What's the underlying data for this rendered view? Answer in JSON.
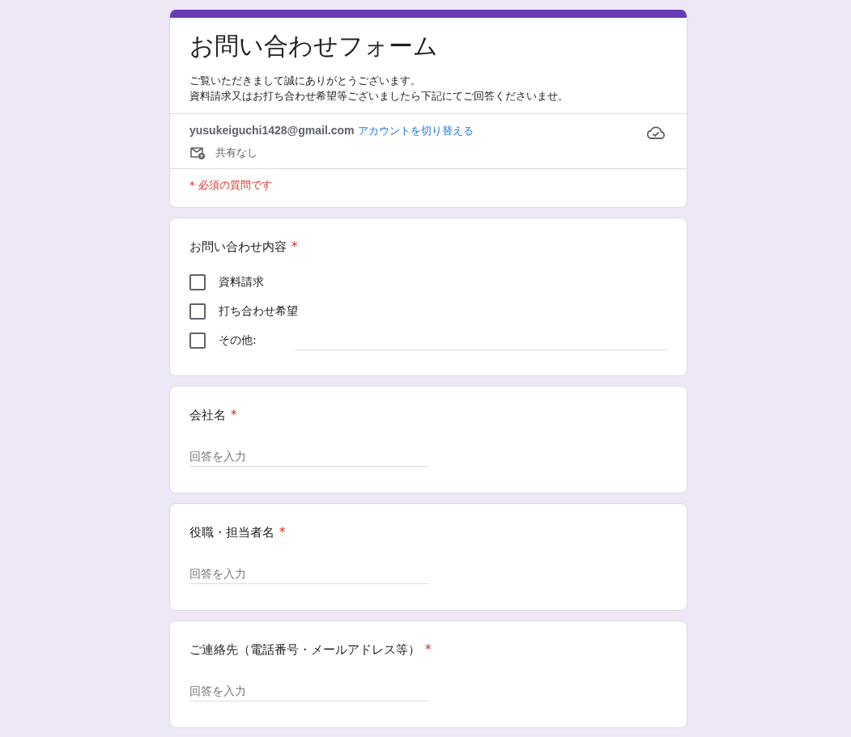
{
  "form": {
    "title": "お問い合わせフォーム",
    "description": [
      "ご覧いただきまして誠にありがとうございます。",
      "資料請求又はお打ち合わせ希望等ございましたら下記にてご回答くださいませ。"
    ],
    "account": {
      "email": "yusukeiguchi1428@gmail.com",
      "switch_link": "アカウントを切り替える",
      "sharing": "共有なし"
    },
    "required_note": "* 必須の質問です"
  },
  "questions": [
    {
      "kind": "checkbox",
      "title": "お問い合わせ内容",
      "required_mark": "*",
      "options": [
        {
          "kind": "choice",
          "label": "資料請求",
          "checked": false
        },
        {
          "kind": "choice",
          "label": "打ち合わせ希望",
          "checked": false
        },
        {
          "kind": "other",
          "label": "その他:",
          "checked": false
        }
      ]
    },
    {
      "kind": "text",
      "title": "会社名",
      "required_mark": "*",
      "placeholder": "回答を入力"
    },
    {
      "kind": "text",
      "title": "役職・担当者名",
      "required_mark": "*",
      "placeholder": "回答を入力"
    },
    {
      "kind": "text",
      "title": "ご連絡先（電話番号・メールアドレス等）",
      "required_mark": "*",
      "placeholder": "回答を入力"
    }
  ]
}
